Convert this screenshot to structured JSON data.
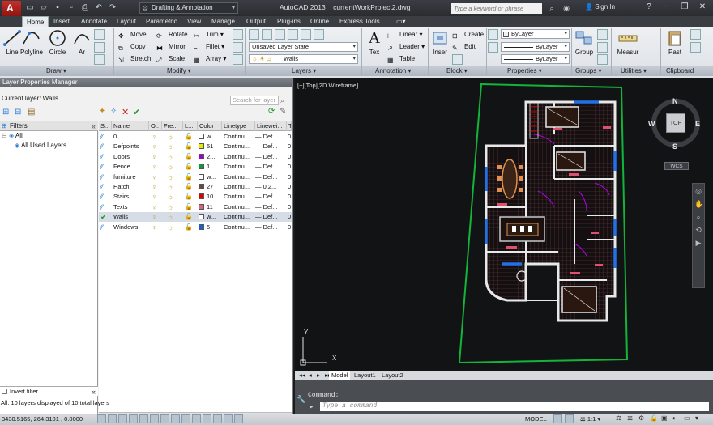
{
  "titlebar": {
    "workspace": "Drafting & Annotation",
    "app_title": "AutoCAD 2013",
    "file_name": "currentWorkProject2.dwg",
    "search_placeholder": "Type a keyword or phrase",
    "sign_in": "Sign In"
  },
  "ribbon_tabs": [
    "Home",
    "Insert",
    "Annotate",
    "Layout",
    "Parametric",
    "View",
    "Manage",
    "Output",
    "Plug-ins",
    "Online",
    "Express Tools"
  ],
  "ribbon": {
    "draw": {
      "label": "Draw",
      "line": "Line",
      "polyline": "Polyline",
      "circle": "Circle",
      "arc": "Ar"
    },
    "modify": {
      "label": "Modify",
      "move": "Move",
      "rotate": "Rotate",
      "trim": "Trim",
      "copy": "Copy",
      "mirror": "Mirror",
      "fillet": "Fillet",
      "stretch": "Stretch",
      "scale": "Scale",
      "array": "Array"
    },
    "layers": {
      "label": "Layers",
      "layer_state": "Unsaved Layer State",
      "current_layer": "Walls"
    },
    "annotation": {
      "label": "Annotation",
      "text": "Tex",
      "linear": "Linear",
      "leader": "Leader",
      "table": "Table"
    },
    "block": {
      "label": "Block",
      "insert": "Inser",
      "create": "Create",
      "edit": "Edit"
    },
    "properties": {
      "label": "Properties",
      "color": "ByLayer",
      "linetype": "ByLayer",
      "lineweight": "ByLayer"
    },
    "groups": {
      "label": "Groups",
      "group": "Group"
    },
    "utilities": {
      "label": "Utilities",
      "measure": "Measur"
    },
    "clipboard": {
      "label": "Clipboard",
      "paste": "Past"
    }
  },
  "layer_manager": {
    "title": "Layer Properties Manager",
    "current_layer": "Current layer: Walls",
    "search_placeholder": "Search for layer",
    "filters_header": "Filters",
    "tree_all": "All",
    "tree_used": "All Used Layers",
    "columns": [
      "S..",
      "Name",
      "O..",
      "Fre...",
      "L...",
      "Color",
      "Linetype",
      "Linewei...",
      "T"
    ],
    "layers": [
      {
        "name": "0",
        "color_name": "w...",
        "color": "#ffffff",
        "linetype": "Continu...",
        "lineweight": "Def...",
        "t": "0"
      },
      {
        "name": "Defpoints",
        "color_name": "51",
        "color": "#e9e900",
        "linetype": "Continu...",
        "lineweight": "Def...",
        "t": "0"
      },
      {
        "name": "Doors",
        "color_name": "2...",
        "color": "#a000c8",
        "linetype": "Continu...",
        "lineweight": "Def...",
        "t": "0"
      },
      {
        "name": "Fence",
        "color_name": "1...",
        "color": "#0a9a3c",
        "linetype": "Continu...",
        "lineweight": "Def...",
        "t": "0"
      },
      {
        "name": "furniture",
        "color_name": "w...",
        "color": "#ffffff",
        "linetype": "Continu...",
        "lineweight": "Def...",
        "t": "0"
      },
      {
        "name": "Hatch",
        "color_name": "27",
        "color": "#6a4a3a",
        "linetype": "Continu...",
        "lineweight": "0.2...",
        "t": "0"
      },
      {
        "name": "Stairs",
        "color_name": "10",
        "color": "#e00000",
        "linetype": "Continu...",
        "lineweight": "Def...",
        "t": "0"
      },
      {
        "name": "Texts",
        "color_name": "11",
        "color": "#e0607a",
        "linetype": "Continu...",
        "lineweight": "Def...",
        "t": "0"
      },
      {
        "name": "Walls",
        "color_name": "w...",
        "color": "#ffffff",
        "linetype": "Continu...",
        "lineweight": "Def...",
        "t": "0",
        "current": true
      },
      {
        "name": "Windows",
        "color_name": "5",
        "color": "#1060e0",
        "linetype": "Continu...",
        "lineweight": "Def...",
        "t": "0"
      }
    ],
    "invert_filter": "Invert filter",
    "status": "All: 10 layers displayed of 10 total layers"
  },
  "viewport": {
    "label": "[−][Top][2D Wireframe]",
    "viewcube": {
      "top": "TOP",
      "n": "N",
      "s": "S",
      "e": "E",
      "w": "W",
      "ucs": "WCS"
    },
    "axis_x": "X",
    "axis_y": "Y"
  },
  "layout_tabs": [
    "Model",
    "Layout1",
    "Layout2"
  ],
  "command": {
    "history": "Command:",
    "placeholder": "Type a command"
  },
  "statusbar": {
    "coords": "3430.5165, 264.3101 , 0.0000",
    "model": "MODEL",
    "scale": "1:1"
  }
}
